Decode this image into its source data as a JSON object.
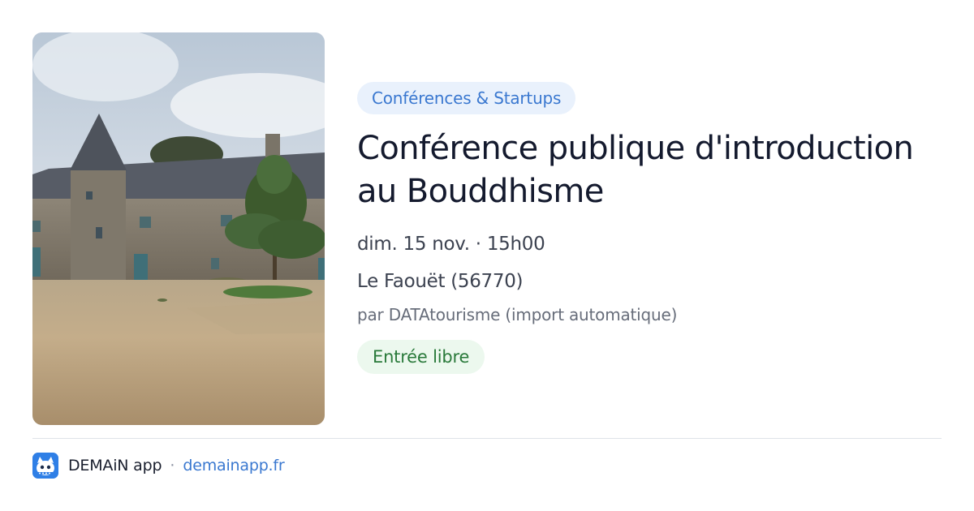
{
  "event": {
    "category": "Conférences & Startups",
    "title": "Conférence publique d'introduction au Bouddhisme",
    "date": "dim. 15 nov. · 15h00",
    "location": "Le Faouët (56770)",
    "organizer": "par DATAtourisme (import automatique)",
    "price": "Entrée libre",
    "image_description": "stone-manor-courtyard-photo"
  },
  "footer": {
    "app_name": "DEMAiN app",
    "separator": "·",
    "domain": "demainapp.fr",
    "icon": "demain-app-logo-icon"
  },
  "colors": {
    "category_badge_bg": "#e9f1fc",
    "category_badge_text": "#3a78d0",
    "price_badge_bg": "#ecf8ee",
    "price_badge_text": "#2a7a3b",
    "title_text": "#141a2e",
    "link": "#3a78d0"
  }
}
